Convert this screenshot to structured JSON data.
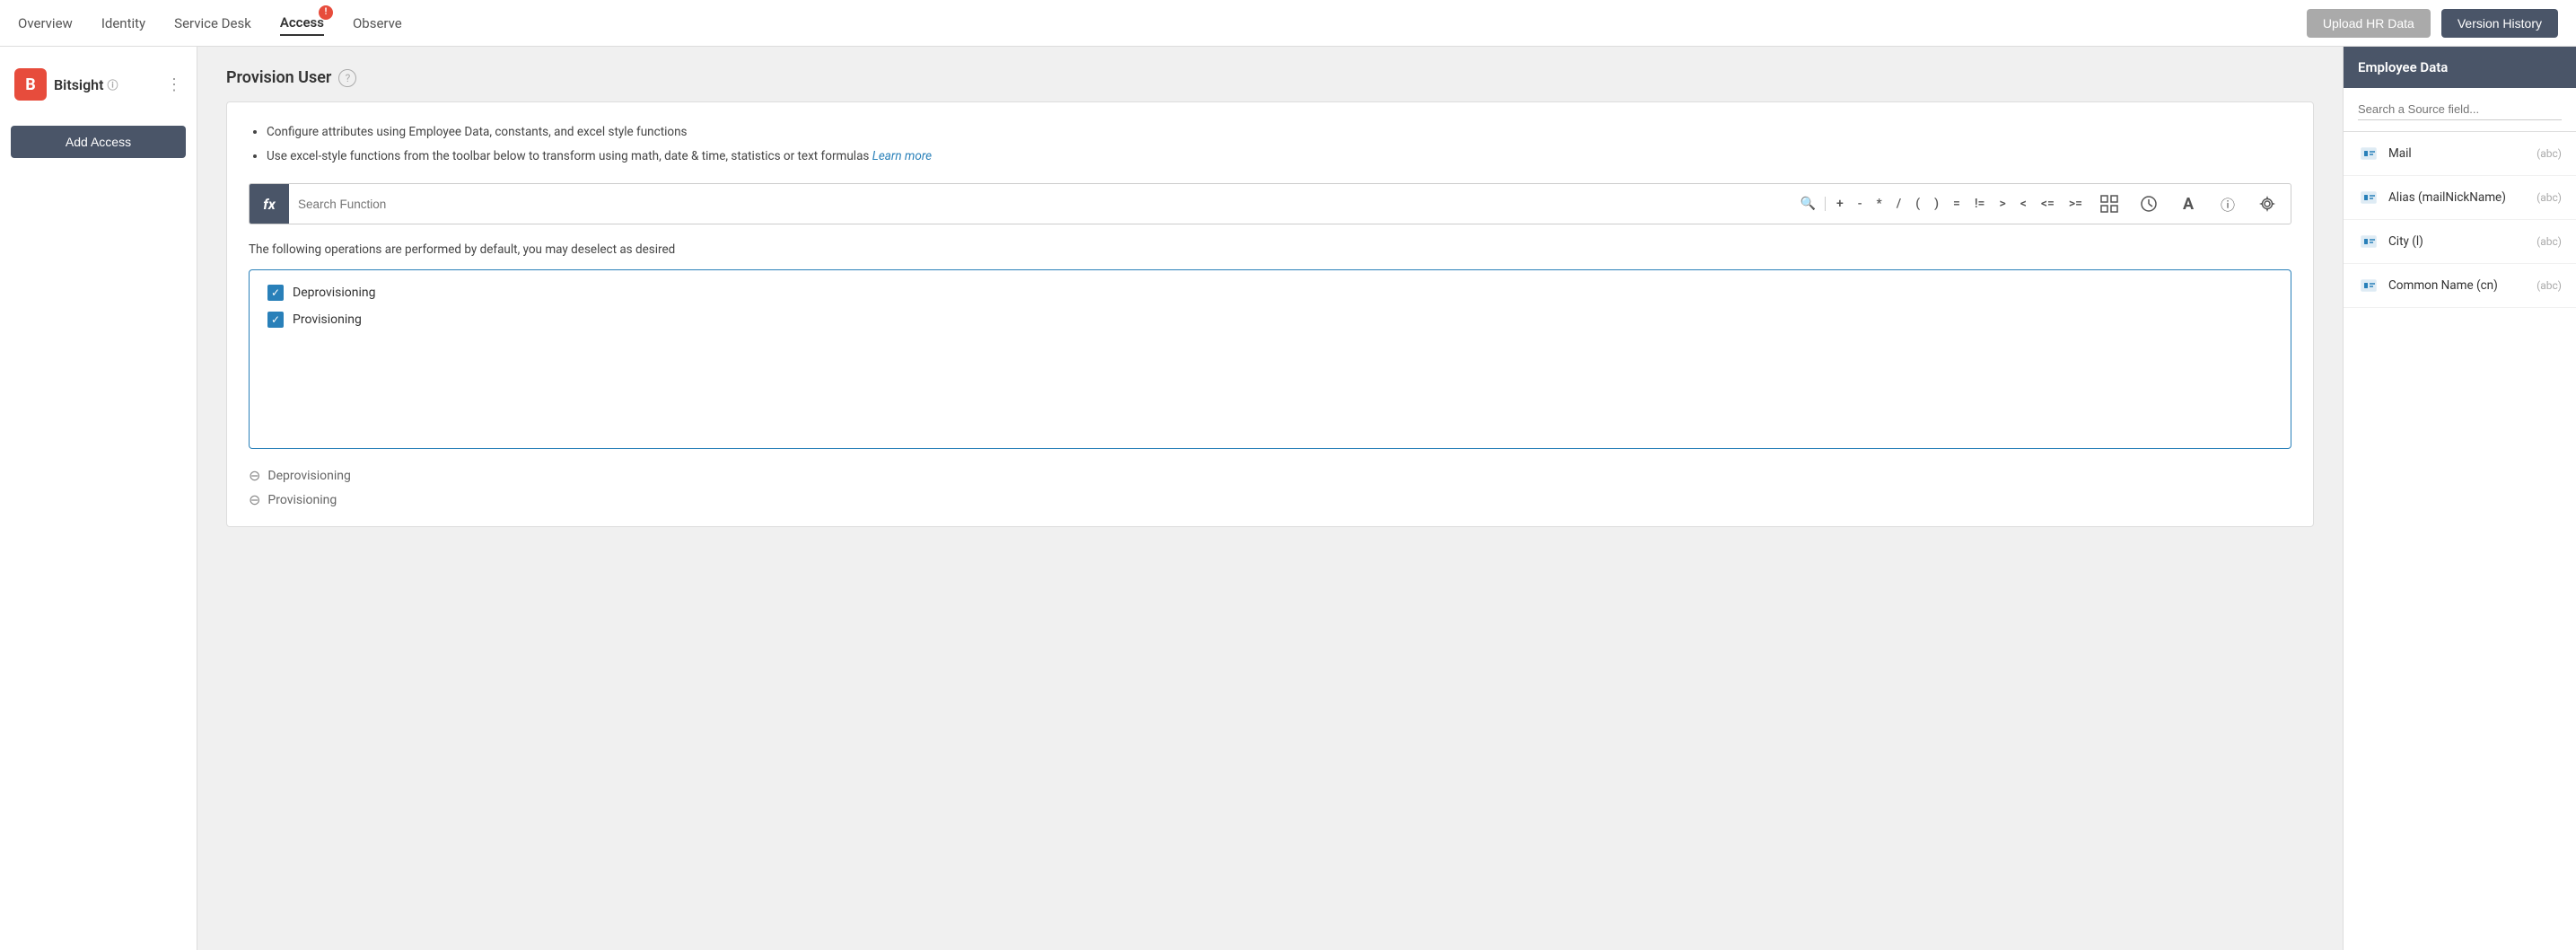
{
  "nav": {
    "items": [
      {
        "label": "Overview",
        "active": false
      },
      {
        "label": "Identity",
        "active": false
      },
      {
        "label": "Service Desk",
        "active": false
      },
      {
        "label": "Access",
        "active": true,
        "badge": "!"
      },
      {
        "label": "Observe",
        "active": false
      }
    ],
    "upload_hr_label": "Upload HR Data",
    "version_history_label": "Version History"
  },
  "sidebar": {
    "logo_letter": "B",
    "logo_name": "Bitsight",
    "add_access_label": "Add Access"
  },
  "provision_user": {
    "title": "Provision User",
    "bullet1": "Configure attributes using Employee Data, constants, and excel style functions",
    "bullet2": "Use excel-style functions from the toolbar below to transform using math, date & time, statistics or text formulas",
    "learn_more": "Learn more",
    "search_placeholder": "Search Function",
    "operators": [
      "+",
      "-",
      "*",
      "/",
      "(",
      ")",
      "=",
      "!=",
      ">",
      "<",
      "<=",
      ">="
    ],
    "operations_text": "The following operations are performed by default, you may deselect as desired",
    "checkboxes": [
      {
        "label": "Deprovisioning",
        "checked": true
      },
      {
        "label": "Provisioning",
        "checked": true
      }
    ],
    "excluded": [
      {
        "label": "Deprovisioning"
      },
      {
        "label": "Provisioning"
      }
    ]
  },
  "employee_data": {
    "title": "Employee Data",
    "search_placeholder": "Search a Source field...",
    "fields": [
      {
        "name": "Mail",
        "type": "(abc)"
      },
      {
        "name": "Alias (mailNickName)",
        "type": "(abc)"
      },
      {
        "name": "City (l)",
        "type": "(abc)"
      },
      {
        "name": "Common Name (cn)",
        "type": "(abc)"
      }
    ]
  }
}
